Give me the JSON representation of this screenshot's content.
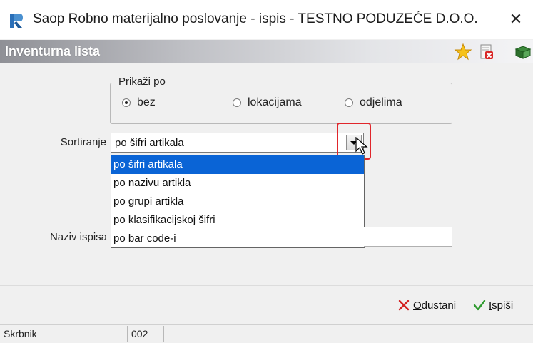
{
  "window": {
    "title": "Saop Robno materijalno poslovanje - ispis - TESTNO PODUZEĆE D.O.O.",
    "close_symbol": "✕",
    "app_icon": "saop-r-icon"
  },
  "header": {
    "title": "Inventurna lista",
    "icons": [
      "star-icon",
      "delete-document-icon",
      "book-exit-icon"
    ]
  },
  "show_by": {
    "legend": "Prikaži po",
    "options": [
      {
        "label": "bez",
        "checked": true
      },
      {
        "label": "lokacijama",
        "checked": false
      },
      {
        "label": "odjelima",
        "checked": false
      }
    ]
  },
  "sort": {
    "label": "Sortiranje",
    "value": "po šifri artikala",
    "options": [
      "po šifri artikala",
      "po nazivu artikla",
      "po grupi artikla",
      "po klasifikacijskoj šifri",
      "po bar code-i"
    ],
    "selected_index": 0
  },
  "print_name": {
    "label": "Naziv ispisa",
    "value": ""
  },
  "buttons": {
    "cancel_mnemonic": "O",
    "cancel_rest": "dustani",
    "print_mnemonic": "I",
    "print_rest": "spiši"
  },
  "statusbar": {
    "user_label": "Skrbnik",
    "user_value": "002",
    "info": ""
  },
  "colors": {
    "selection": "#0a64d6",
    "highlight_box": "#e0262b",
    "cancel_x": "#d32020",
    "print_check": "#2e9a2e"
  }
}
